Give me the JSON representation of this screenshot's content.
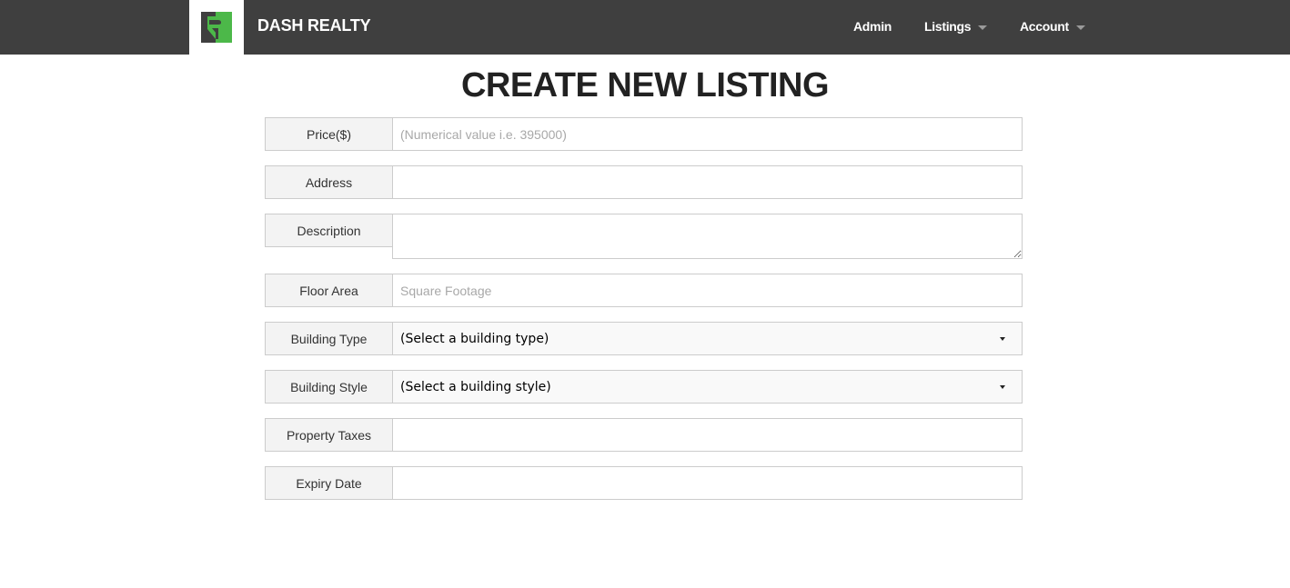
{
  "navbar": {
    "brand": "DASH REALTY",
    "logo_icon": "dash-realty-logo-icon",
    "colors": {
      "background": "#3f3f3f",
      "logo_green": "#4cb849",
      "logo_dark": "#3f3f3f"
    },
    "items": [
      {
        "label": "Admin",
        "has_dropdown": false
      },
      {
        "label": "Listings",
        "has_dropdown": true
      },
      {
        "label": "Account",
        "has_dropdown": true
      }
    ]
  },
  "page": {
    "title": "CREATE NEW LISTING"
  },
  "form": {
    "price": {
      "label": "Price($)",
      "placeholder": "(Numerical value i.e. 395000)",
      "value": ""
    },
    "address": {
      "label": "Address",
      "placeholder": "",
      "value": ""
    },
    "description": {
      "label": "Description",
      "placeholder": "",
      "value": ""
    },
    "floor_area": {
      "label": "Floor Area",
      "placeholder": "Square Footage",
      "value": ""
    },
    "building_type": {
      "label": "Building Type",
      "selected": "(Select a building type)"
    },
    "building_style": {
      "label": "Building Style",
      "selected": "(Select a building style)"
    },
    "property_taxes": {
      "label": "Property Taxes",
      "placeholder": "",
      "value": ""
    },
    "expiry_date": {
      "label": "Expiry Date",
      "placeholder": "",
      "value": ""
    }
  }
}
